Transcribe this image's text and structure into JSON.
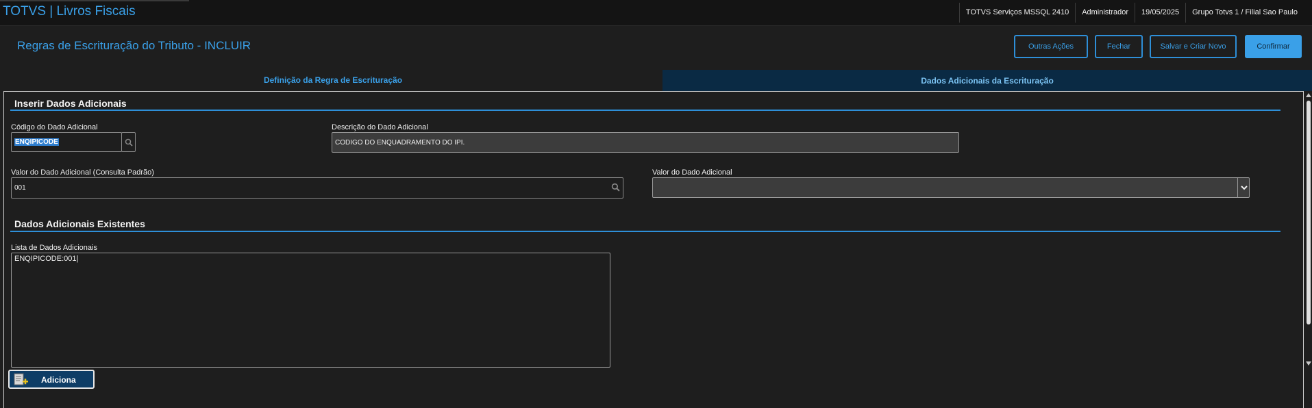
{
  "app": {
    "title": "TOTVS | Livros Fiscais",
    "status": [
      "TOTVS Serviços MSSQL 2410",
      "Administrador",
      "19/05/2025",
      "Grupo Totvs 1 / Filial Sao Paulo"
    ]
  },
  "page": {
    "title": "Regras de Escrituração do Tributo - INCLUIR"
  },
  "actions": {
    "outras": "Outras Ações",
    "fechar": "Fechar",
    "salvar_novo": "Salvar e Criar Novo",
    "confirmar": "Confirmar"
  },
  "tabs": [
    {
      "label": "Definição da Regra de Escrituração",
      "active": false
    },
    {
      "label": "Dados Adicionais da Escrituração",
      "active": true
    }
  ],
  "inserir": {
    "title": "Inserir Dados Adicionais",
    "codigo_label": "Código do Dado Adicional",
    "codigo_value": "ENQIPICODE",
    "descricao_label": "Descrição do Dado Adicional",
    "descricao_value": "CODIGO DO ENQUADRAMENTO DO IPI.",
    "valor_consulta_label": "Valor do Dado Adicional (Consulta Padrão)",
    "valor_consulta_value": "001",
    "valor_label": "Valor do Dado Adicional",
    "valor_value": ""
  },
  "existentes": {
    "title": "Dados Adicionais Existentes",
    "lista_label": "Lista de Dados Adicionais",
    "lista_value": "ENQIPICODE:001|"
  },
  "add_button": "Adiciona",
  "colors": {
    "accent": "#3aa0e8",
    "background": "#1e1e1e",
    "active_tab": "#0a2a44"
  }
}
